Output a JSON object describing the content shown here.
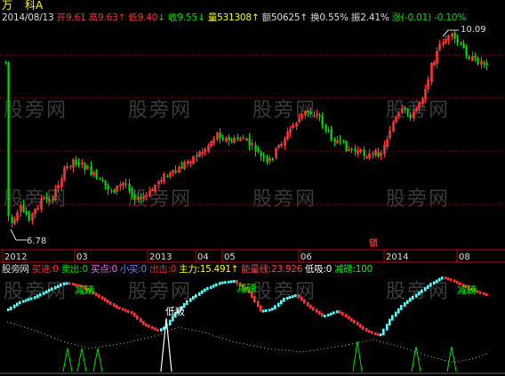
{
  "header": {
    "logo_char": "万",
    "stock_name": "科A",
    "date": "2014/08/13",
    "open_label": "开",
    "open": "9.61",
    "high_label": "高",
    "high": "9.63",
    "low_label": "低",
    "low": "9.40",
    "close_label": "收",
    "close": "9.55",
    "volume_label": "量",
    "volume": "531308",
    "amount_label": "额",
    "amount": "50625",
    "turnover_label": "换",
    "turnover": "0.55%",
    "amplitude_label": "振",
    "amplitude": "2.41%",
    "change_label": "涨",
    "change": "(-0.01)",
    "change_pct": "-0.10%",
    "arrows": [
      "↑",
      "↓",
      "↓",
      "↓",
      "↑",
      "↑",
      "↑"
    ]
  },
  "chart_annotations": {
    "max_label": "10.09",
    "min_label": "6.78",
    "event_marker": "锁"
  },
  "time_axis": [
    "2012",
    "03",
    "2013",
    "04",
    "05",
    "06",
    "2014",
    "08"
  ],
  "indicator_bar": {
    "name": "股旁网",
    "items": [
      {
        "label": "买进:",
        "value": "0",
        "color": "#ff3030"
      },
      {
        "label": "卖出:",
        "value": "0",
        "color": "#00e000"
      },
      {
        "label": "买点:",
        "value": "0",
        "color": "#ff60ff"
      },
      {
        "label": "小买:",
        "value": "0",
        "color": "#6060ff"
      },
      {
        "label": "出击:",
        "value": "0",
        "color": "#ff2020"
      },
      {
        "label": "主力:",
        "value": "15.491",
        "color": "#ffff00"
      },
      {
        "label": "能量线:",
        "value": "23.926",
        "color": "#ff4040"
      },
      {
        "label": "低吸:",
        "value": "0",
        "color": "#ffffff"
      },
      {
        "label": "减磅:",
        "value": "100",
        "color": "#00ff00"
      }
    ],
    "arrow": "↑"
  },
  "signals": {
    "reduce_1": "减磅",
    "reduce_2": "减磅",
    "reduce_3": "减磅",
    "lowbuy": "低吸"
  },
  "watermark": "股旁网",
  "colors": {
    "up": "#ff3232",
    "down": "#54fcfc",
    "green_candle": "#00e000",
    "grid": "#a00000",
    "axis": "#c00000"
  },
  "chart_data": {
    "type": "candlestick",
    "price_max": 10.09,
    "price_min": 6.78,
    "last_bar": {
      "open": 9.61,
      "high": 9.63,
      "low": 9.4,
      "close": 9.55
    }
  }
}
